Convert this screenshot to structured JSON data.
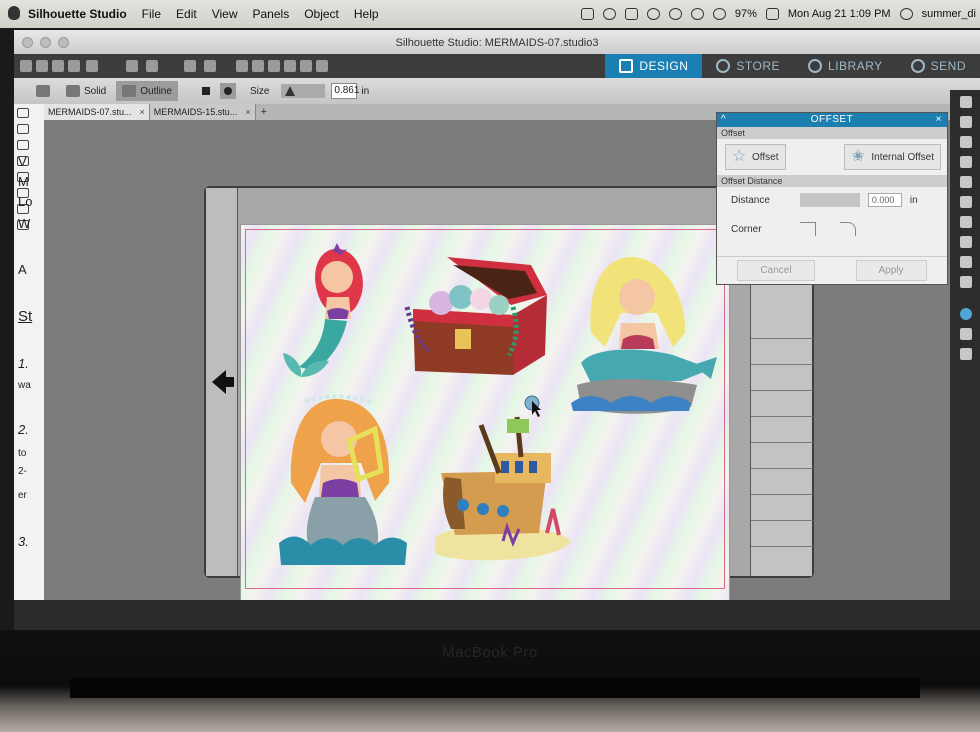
{
  "menubar": {
    "app_name": "Silhouette Studio",
    "menus": [
      "File",
      "Edit",
      "View",
      "Panels",
      "Object",
      "Help"
    ],
    "battery": "97%",
    "datetime": "Mon Aug 21  1:09 PM",
    "user": "summer_di"
  },
  "window": {
    "title": "Silhouette Studio: MERMAIDS-07.studio3"
  },
  "navtabs": [
    {
      "label": "DESIGN",
      "icon": "grid-icon",
      "active": true
    },
    {
      "label": "STORE",
      "icon": "store-icon",
      "active": false
    },
    {
      "label": "LIBRARY",
      "icon": "cloud-icon",
      "active": false
    },
    {
      "label": "SEND",
      "icon": "send-icon",
      "active": false
    }
  ],
  "toolbar2": {
    "solid_label": "Solid",
    "outline_label": "Outline",
    "size_label": "Size",
    "size_value": "0.861",
    "size_unit": "in"
  },
  "doctabs": [
    {
      "label": "MERMAIDS-07.stu...",
      "close": "×"
    },
    {
      "label": "MERMAIDS-15.stu...",
      "close": "×"
    }
  ],
  "doctabs_add": "+",
  "left_fragments": [
    "V",
    "M",
    "Lo",
    "W",
    "A",
    "St",
    "1.",
    "wa",
    "2.",
    "to",
    "2-",
    "er",
    "3."
  ],
  "offset_panel": {
    "title": "OFFSET",
    "caret": "^",
    "close": "×",
    "section_offset": "Offset",
    "offset_button": "Offset",
    "internal_offset_button": "Internal Offset",
    "section_distance": "Offset Distance",
    "distance_label": "Distance",
    "distance_value": "0.000",
    "distance_unit": "in",
    "corner_label": "Corner",
    "cancel_label": "Cancel",
    "apply_label": "Apply"
  },
  "bezel_text": "MacBook Pro"
}
